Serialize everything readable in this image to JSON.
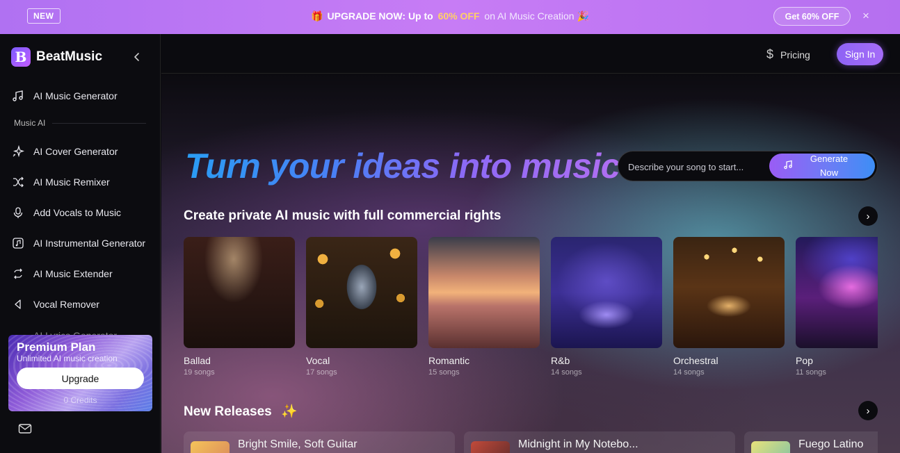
{
  "promo": {
    "badge": "NEW",
    "gift": "🎁",
    "headline": "UPGRADE NOW: Up to",
    "discount": "60% OFF",
    "tail": "on AI Music Creation",
    "party": "🎉",
    "cta": "Get 60% OFF",
    "close": "×"
  },
  "brand": {
    "logo_letter": "B",
    "name": "BeatMusic"
  },
  "sidebar": {
    "top_item": "AI Music Generator",
    "section": "Music AI",
    "items": [
      {
        "label": "AI Cover Generator",
        "icon": "sparkle-icon"
      },
      {
        "label": "AI Music Remixer",
        "icon": "shuffle-icon"
      },
      {
        "label": "Add Vocals to Music",
        "icon": "microphone-icon"
      },
      {
        "label": "AI Instrumental Generator",
        "icon": "music-note-box-icon"
      },
      {
        "label": "AI Music Extender",
        "icon": "repeat-icon"
      },
      {
        "label": "Vocal Remover",
        "icon": "speaker-icon"
      }
    ],
    "cutoff_item": "AI Lyrics Generator",
    "premium": {
      "title": "Premium Plan",
      "subtitle": "Unlimited AI music creation",
      "button": "Upgrade",
      "credits": "0 Credits"
    }
  },
  "topnav": {
    "pricing": "Pricing",
    "signin": "Sign In"
  },
  "hero": {
    "title": "Turn your ideas into music",
    "placeholder": "Describe your song to start...",
    "generate_line1": "Generate",
    "generate_line2": "Now"
  },
  "genres": {
    "title": "Create private AI music with full commercial rights",
    "items": [
      {
        "name": "Ballad",
        "count": "19 songs"
      },
      {
        "name": "Vocal",
        "count": "17 songs"
      },
      {
        "name": "Romantic",
        "count": "15 songs"
      },
      {
        "name": "R&b",
        "count": "14 songs"
      },
      {
        "name": "Orchestral",
        "count": "14 songs"
      },
      {
        "name": "Pop",
        "count": "11 songs"
      }
    ]
  },
  "releases": {
    "title": "New Releases",
    "emoji": "✨",
    "items": [
      {
        "title": "Bright Smile, Soft Guitar"
      },
      {
        "title": "Midnight in My Notebo..."
      },
      {
        "title": "Fuego Latino"
      }
    ]
  },
  "colors": {
    "accent": "#a56cf7",
    "promo_bg": "#c77cf5",
    "discount": "#ffd166"
  }
}
